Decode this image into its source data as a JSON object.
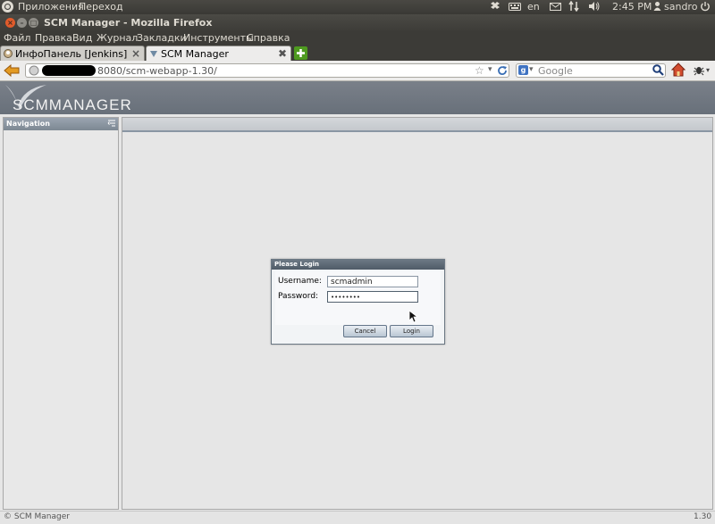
{
  "top_panel": {
    "applications": "Приложения",
    "places": "Переход",
    "keyboard_layout": "en",
    "clock": "2:45 PM",
    "user": "sandro"
  },
  "window": {
    "title": "SCM Manager - Mozilla Firefox"
  },
  "menu": {
    "items": [
      "Файл",
      "Правка",
      "Вид",
      "Журнал",
      "Закладки",
      "Инструменты",
      "Справка"
    ]
  },
  "tabs": [
    {
      "label": "ИнфоПанель [Jenkins]",
      "active": false
    },
    {
      "label": "SCM Manager",
      "active": true
    }
  ],
  "address_bar": {
    "url": "8080/scm-webapp-1.30/"
  },
  "search_bar": {
    "placeholder": "Google"
  },
  "app": {
    "logo_text": "SCMMANAGER",
    "nav_title": "Navigation"
  },
  "login": {
    "title": "Please Login",
    "username_label": "Username:",
    "username_value": "scmadmin",
    "password_label": "Password:",
    "password_value": "••••••••",
    "cancel_label": "Cancel",
    "login_label": "Login"
  },
  "footer": {
    "copyright": "© SCM Manager",
    "version": "1.30"
  },
  "colors": {
    "header_bg": "#6f7781",
    "dialog_title_bg": "#56626e",
    "panel_dark": "#3c3b37"
  }
}
